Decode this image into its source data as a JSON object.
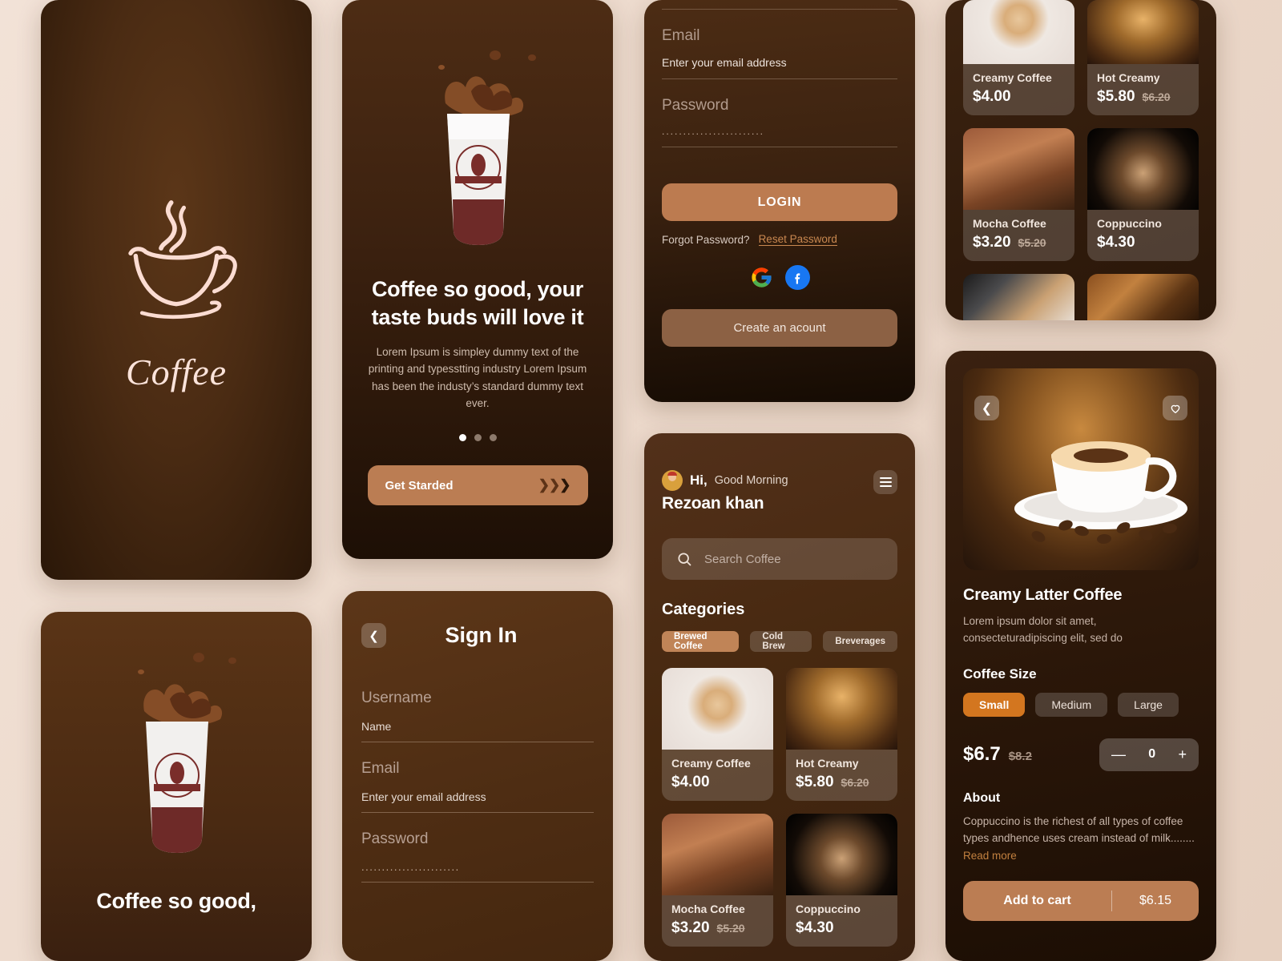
{
  "colors": {
    "background": "#ecdace",
    "accent": "#bb7d53",
    "accent_strong": "#d3761f",
    "dark_brown": "#4a2a12",
    "link": "#c98850"
  },
  "splash": {
    "brand": "Coffee",
    "logo_icon": "coffee-cup-icon"
  },
  "onboarding": {
    "headline": "Coffee so good, your taste buds will love it",
    "body": "Lorem Ipsum is simpley dummy text of the printing and typesstting industry Lorem Ipsum has been the industy’s standard dummy text ever.",
    "cta_label": "Get Starded",
    "cta_icon": "chevrons-right-icon",
    "dots": [
      {
        "active": true
      },
      {
        "active": false
      },
      {
        "active": false
      }
    ],
    "image_alt": "coffee-mockup-cup-splash"
  },
  "onboarding2": {
    "headline": "Coffee so good,",
    "image_alt": "coffee-mockup-cup-splash"
  },
  "signin": {
    "title": "Sign In",
    "back_icon": "chevron-left-icon",
    "fields": [
      {
        "label": "Username",
        "value": "Name",
        "type": "text"
      },
      {
        "label": "Email",
        "value": "Enter your email address",
        "type": "text"
      },
      {
        "label": "Password",
        "value": "........................",
        "type": "password"
      }
    ]
  },
  "login": {
    "fields": [
      {
        "label": "Email",
        "value": "Enter your email address",
        "type": "text"
      },
      {
        "label": "Password",
        "value": "........................",
        "type": "password"
      }
    ],
    "login_button": "LOGIN",
    "forgot_text": "Forgot Password?",
    "reset_link": "Reset Password",
    "socials": [
      {
        "name": "google-icon"
      },
      {
        "name": "facebook-icon"
      }
    ],
    "create_button": "Create an acount"
  },
  "home": {
    "greeting_hi": "Hi,",
    "greeting_time": "Good Morning",
    "user_name": "Rezoan khan",
    "menu_icon": "hamburger-menu-icon",
    "avatar_icon": "user-avatar",
    "search_icon": "search-icon",
    "search_placeholder": "Search Coffee",
    "categories_title": "Categories",
    "categories": [
      {
        "label": "Brewed Coffee",
        "selected": true
      },
      {
        "label": "Cold Brew",
        "selected": false
      },
      {
        "label": "Breverages",
        "selected": false
      }
    ],
    "products": [
      {
        "name": "Creamy Coffee",
        "price": "$4.00",
        "old_price": "",
        "thumb": "latte-art-top-view"
      },
      {
        "name": "Hot Creamy",
        "price": "$5.80",
        "old_price": "$6.20",
        "thumb": "hot-cappuccino-wood"
      },
      {
        "name": "Mocha Coffee",
        "price": "$3.20",
        "old_price": "$5.20",
        "thumb": "glass-cup-beans"
      },
      {
        "name": "Coppuccino",
        "price": "$4.30",
        "old_price": "",
        "thumb": "cinnamon-cappuccino-black"
      }
    ]
  },
  "grid_panel": {
    "products": [
      {
        "name": "Creamy Coffee",
        "price": "$4.00",
        "old_price": "",
        "thumb": "latte-art-top-view"
      },
      {
        "name": "Hot Creamy",
        "price": "$5.80",
        "old_price": "$6.20",
        "thumb": "hot-cappuccino-wood"
      },
      {
        "name": "Mocha Coffee",
        "price": "$3.20",
        "old_price": "$5.20",
        "thumb": "glass-cup-beans"
      },
      {
        "name": "Coppuccino",
        "price": "$4.30",
        "old_price": "",
        "thumb": "cinnamon-cappuccino-black"
      }
    ],
    "partial_thumbs": [
      {
        "thumb": "barista-pouring-latte"
      },
      {
        "thumb": "coffee-beans-cup"
      }
    ]
  },
  "detail": {
    "back_icon": "chevron-left-icon",
    "favorite_icon": "heart-icon",
    "hero_alt": "steaming-cappuccino-cup",
    "title": "Creamy Latter Coffee",
    "description": "Lorem ipsum dolor sit amet, consecteturadipiscing elit, sed do",
    "size_title": "Coffee Size",
    "sizes": [
      {
        "label": "Small",
        "selected": true
      },
      {
        "label": "Medium",
        "selected": false
      },
      {
        "label": "Large",
        "selected": false
      }
    ],
    "price": "$6.7",
    "old_price": "$8.2",
    "quantity": "0",
    "minus_icon": "minus-icon",
    "plus_icon": "plus-icon",
    "about_title": "About",
    "about_text": "Coppuccino is the richest of all types of coffee types andhence uses cream instead of milk........ ",
    "read_more": "Read more",
    "cart_label": "Add to cart",
    "cart_amount": "$6.15"
  }
}
